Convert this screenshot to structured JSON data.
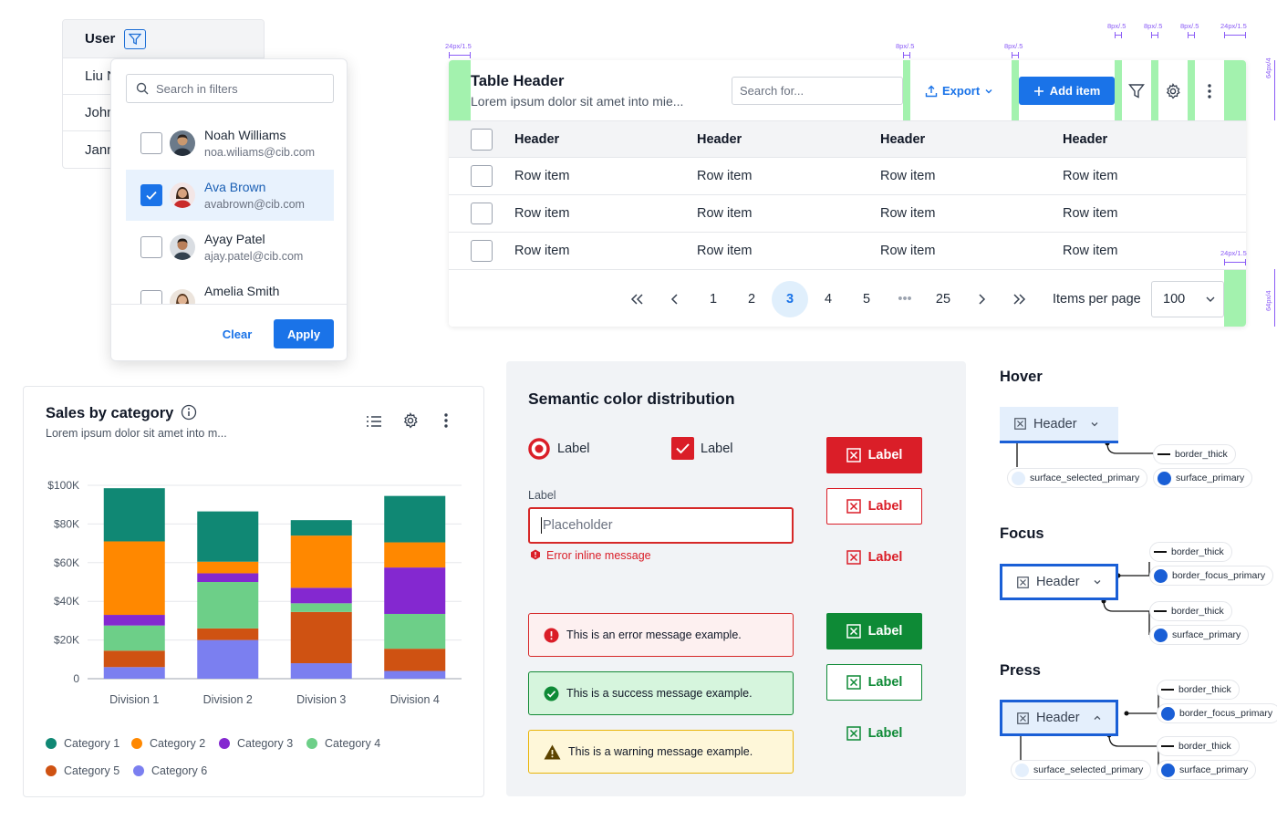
{
  "user_table": {
    "header": "User",
    "rows": [
      "Liu N",
      "John",
      "Jann"
    ]
  },
  "filter": {
    "search_placeholder": "Search in filters",
    "items": [
      {
        "name": "Noah Williams",
        "email": "noa.wiliams@cib.com",
        "checked": false
      },
      {
        "name": "Ava Brown",
        "email": "avabrown@cib.com",
        "checked": true
      },
      {
        "name": "Ayay Patel",
        "email": "ajay.patel@cib.com",
        "checked": false
      },
      {
        "name": "Amelia Smith",
        "email": "",
        "checked": false
      }
    ],
    "clear_label": "Clear",
    "apply_label": "Apply"
  },
  "data_table": {
    "title": "Table Header",
    "subtitle": "Lorem ipsum dolor sit amet into mie...",
    "search_placeholder": "Search for...",
    "export_label": "Export",
    "add_label": "Add item",
    "headers": [
      "Header",
      "Header",
      "Header",
      "Header"
    ],
    "rows": [
      [
        "Row item",
        "Row item",
        "Row item",
        "Row item"
      ],
      [
        "Row item",
        "Row item",
        "Row item",
        "Row item"
      ],
      [
        "Row item",
        "Row item",
        "Row item",
        "Row item"
      ]
    ],
    "pagination": {
      "pages": [
        "1",
        "2",
        "3",
        "4",
        "5",
        "•••",
        "25"
      ],
      "active": "3",
      "items_per_page_label": "Items per page",
      "items_per_page_value": "100"
    },
    "annotations": {
      "a1": "24px/1.5",
      "a2": "8px/.5",
      "a3": "8px/.5",
      "a4": "8px/.5",
      "a5": "8px/.5",
      "a6": "8px/.5",
      "a7": "24px/1.5",
      "a8": "24px/1.5",
      "v1": "64px/4",
      "v2": "64px/4"
    }
  },
  "chart": {
    "title": "Sales by category",
    "subtitle": "Lorem ipsum dolor sit amet into m...",
    "legend": [
      "Category 1",
      "Category 2",
      "Category 3",
      "Category 4",
      "Category 5",
      "Category 6"
    ]
  },
  "chart_data": {
    "type": "bar",
    "stacked": true,
    "categories": [
      "Division 1",
      "Division 2",
      "Division 3",
      "Division 4"
    ],
    "ylim": [
      0,
      100000
    ],
    "yticks": [
      "$100K",
      "$80K",
      "$60K",
      "$40K",
      "$20K",
      "0"
    ],
    "ytick_values": [
      100000,
      80000,
      60000,
      40000,
      20000,
      0
    ],
    "grid": true,
    "legend_position": "bottom",
    "series": [
      {
        "name": "Category 6",
        "color": "#7b7ff0",
        "values": [
          6000,
          20000,
          8000,
          4000
        ]
      },
      {
        "name": "Category 5",
        "color": "#cf5212",
        "values": [
          8500,
          6000,
          26500,
          11500
        ]
      },
      {
        "name": "Category 4",
        "color": "#6dcf88",
        "values": [
          13000,
          24000,
          4500,
          18000
        ]
      },
      {
        "name": "Category 3",
        "color": "#8428d0",
        "values": [
          5500,
          4500,
          8000,
          24000
        ]
      },
      {
        "name": "Category 2",
        "color": "#ff8800",
        "values": [
          38000,
          6000,
          27000,
          13000
        ]
      },
      {
        "name": "Category 1",
        "color": "#108874",
        "values": [
          27500,
          26000,
          8000,
          24000
        ]
      }
    ]
  },
  "semantic": {
    "title": "Semantic color distribution",
    "radio_label": "Label",
    "checkbox_label": "Label",
    "field_label": "Label",
    "field_placeholder": "Placeholder",
    "error_inline": "Error inline message",
    "error_msg": "This is an error message example.",
    "success_msg": "This is a success message example.",
    "warning_msg": "This is a warning message example.",
    "button_label": "Label",
    "colors": {
      "error": "#da1e28",
      "success": "#0e8a36",
      "warning": "#e9b409",
      "primary": "#1a73e8"
    }
  },
  "states": {
    "hover": {
      "title": "Hover",
      "header": "Header",
      "tokens": [
        "border_thick",
        "surface_selected_primary",
        "surface_primary"
      ]
    },
    "focus": {
      "title": "Focus",
      "header": "Header",
      "tokens": [
        "border_thick",
        "border_focus_primary",
        "border_thick",
        "surface_primary"
      ]
    },
    "press": {
      "title": "Press",
      "header": "Header",
      "tokens": [
        "border_thick",
        "border_focus_primary",
        "border_thick",
        "surface_selected_primary",
        "surface_primary"
      ]
    }
  }
}
